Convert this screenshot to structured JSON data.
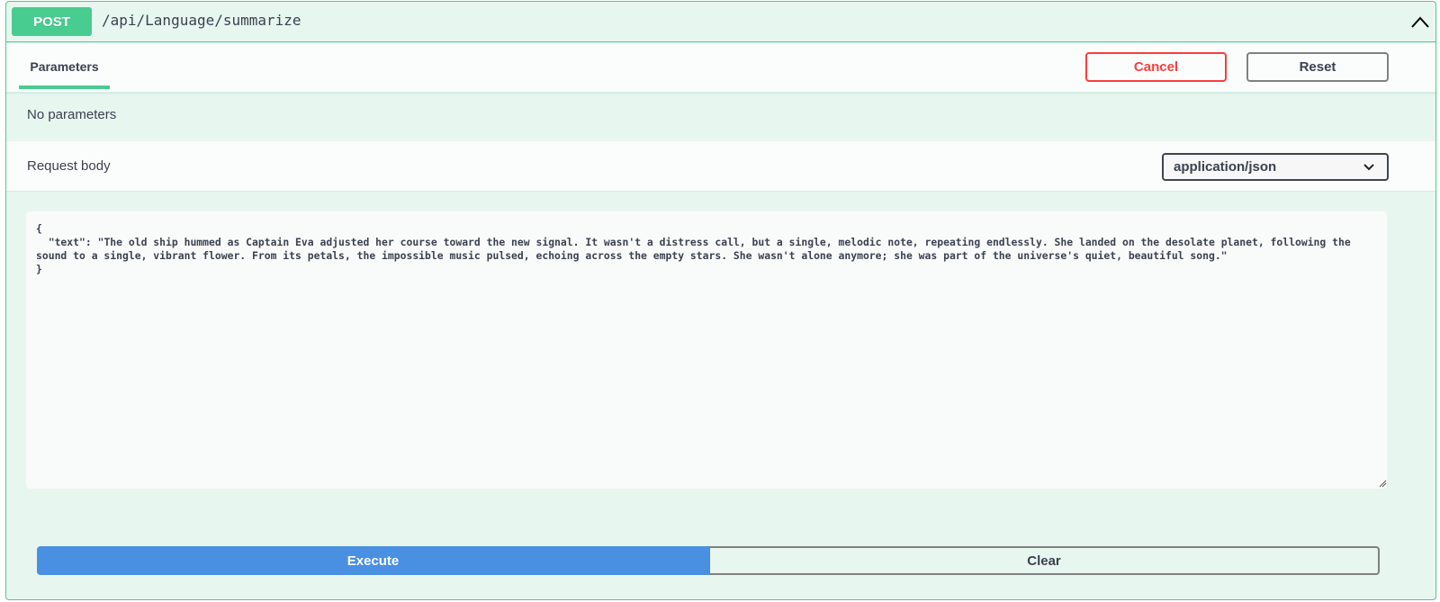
{
  "operation": {
    "method": "POST",
    "path": "/api/Language/summarize",
    "collapse_icon": "chevron-up-icon"
  },
  "parameters": {
    "tab_label": "Parameters",
    "cancel_label": "Cancel",
    "reset_label": "Reset",
    "empty_text": "No parameters"
  },
  "request_body": {
    "title": "Request body",
    "content_type": "application/json",
    "dropdown_icon": "chevron-down-icon",
    "value": "{\n  \"text\": \"The old ship hummed as Captain Eva adjusted her course toward the new signal. It wasn't a distress call, but a single, melodic note, repeating endlessly. She landed on the desolate planet, following the sound to a single, vibrant flower. From its petals, the impossible music pulsed, echoing across the empty stars. She wasn't alone anymore; she was part of the universe's quiet, beautiful song.\"\n}"
  },
  "actions": {
    "execute_label": "Execute",
    "clear_label": "Clear"
  },
  "colors": {
    "accent_post": "#49cc90",
    "cancel": "#f93e3e",
    "execute": "#4990e2",
    "panel_bg": "#e8f6f0"
  }
}
